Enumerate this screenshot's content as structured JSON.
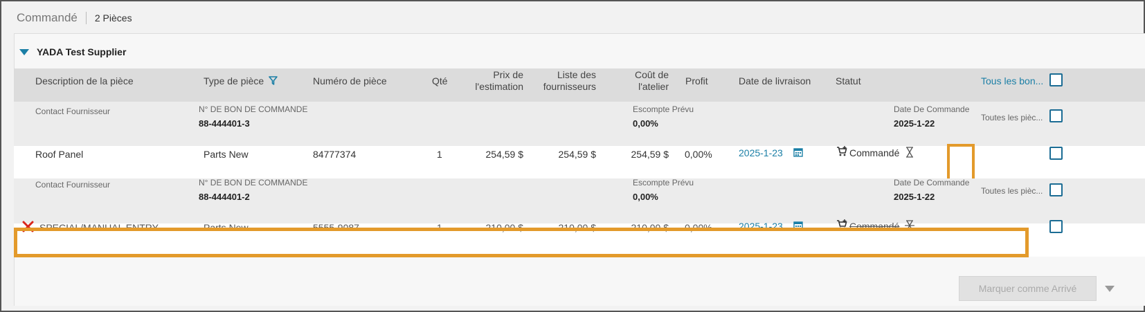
{
  "header": {
    "title": "Commandé",
    "count": "2 Pièces"
  },
  "supplier": {
    "name": "YADA Test Supplier"
  },
  "columns": {
    "description": "Description de la pièce",
    "type": "Type de pièce",
    "number": "Numéro de pièce",
    "qty": "Qté",
    "estimate_price_l1": "Prix de",
    "estimate_price_l2": "l'estimation",
    "supplier_list_l1": "Liste des",
    "supplier_list_l2": "fournisseurs",
    "shop_cost_l1": "Coût de",
    "shop_cost_l2": "l'atelier",
    "profit": "Profit",
    "delivery_date": "Date de livraison",
    "status": "Statut",
    "all_link": "Tous les bon..."
  },
  "po_groups": [
    {
      "contact_label": "Contact Fournisseur",
      "po_label": "N° DE BON DE COMMANDE",
      "po_number": "88-444401-3",
      "discount_label": "Escompte Prévu",
      "discount_value": "0,00%",
      "order_date_label": "Date De Commande",
      "order_date": "2025-1-22",
      "all_parts": "Toutes les pièc...",
      "item": {
        "description": "Roof Panel",
        "type": "Parts New",
        "number": "84777374",
        "qty": "1",
        "estimate_price": "254,59 $",
        "supplier_list": "254,59 $",
        "shop_cost": "254,59 $",
        "profit": "0,00%",
        "delivery_date": "2025-1-23",
        "status": "Commandé"
      }
    },
    {
      "contact_label": "Contact Fournisseur",
      "po_label": "N° DE BON DE COMMANDE",
      "po_number": "88-444401-2",
      "discount_label": "Escompte Prévu",
      "discount_value": "0,00%",
      "order_date_label": "Date De Commande",
      "order_date": "2025-1-22",
      "all_parts": "Toutes les pièc...",
      "item": {
        "description": "SPECIAL/MANUAL ENTRY",
        "type": "Parts New",
        "number": "5555-9087",
        "qty": "1",
        "estimate_price": "210,00 $",
        "supplier_list": "210,00 $",
        "shop_cost": "210,00 $",
        "profit": "0,00%",
        "delivery_date": "2025-1-23",
        "status": "Commandé"
      }
    }
  ],
  "footer": {
    "mark_arrived": "Marquer comme Arrivé"
  },
  "colors": {
    "accent": "#1b7fa6",
    "highlight": "#e39a2b",
    "delete": "#d9261c"
  },
  "icons": [
    "filter-icon",
    "calendar-icon",
    "cart-icon",
    "hourglass-icon",
    "delete-icon",
    "chevron-down-icon"
  ]
}
